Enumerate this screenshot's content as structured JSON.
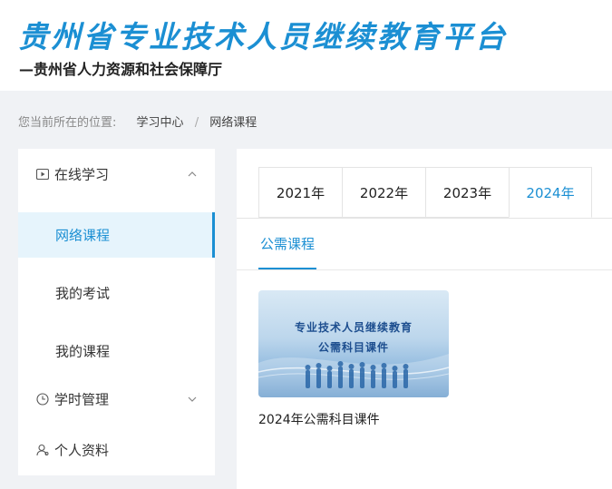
{
  "header": {
    "title": "贵州省专业技术人员继续教育平台",
    "subtitle": "—贵州省人力资源和社会保障厅"
  },
  "breadcrumb": {
    "prefix": "您当前所在的位置:",
    "items": [
      "学习中心",
      "网络课程"
    ],
    "separator": "/"
  },
  "sidebar": {
    "groups": [
      {
        "label": "在线学习",
        "icon": "video-icon",
        "expanded": true,
        "items": [
          {
            "label": "网络课程",
            "active": true
          },
          {
            "label": "我的考试",
            "active": false
          },
          {
            "label": "我的课程",
            "active": false
          }
        ]
      },
      {
        "label": "学时管理",
        "icon": "clock-icon",
        "expanded": false
      },
      {
        "label": "个人资料",
        "icon": "user-icon",
        "expanded": false
      }
    ]
  },
  "year_tabs": [
    {
      "label": "2021年",
      "active": false
    },
    {
      "label": "2022年",
      "active": false
    },
    {
      "label": "2023年",
      "active": false
    },
    {
      "label": "2024年",
      "active": true
    }
  ],
  "sub_tabs": [
    {
      "label": "公需课程",
      "active": true
    }
  ],
  "courses": [
    {
      "thumbnail_line1": "专业技术人员继续教育",
      "thumbnail_line2": "公需科目课件",
      "title": "2024年公需科目课件"
    }
  ],
  "colors": {
    "accent": "#1b8fd3",
    "background": "#f0f2f5",
    "active_bg": "#e6f4fc"
  }
}
